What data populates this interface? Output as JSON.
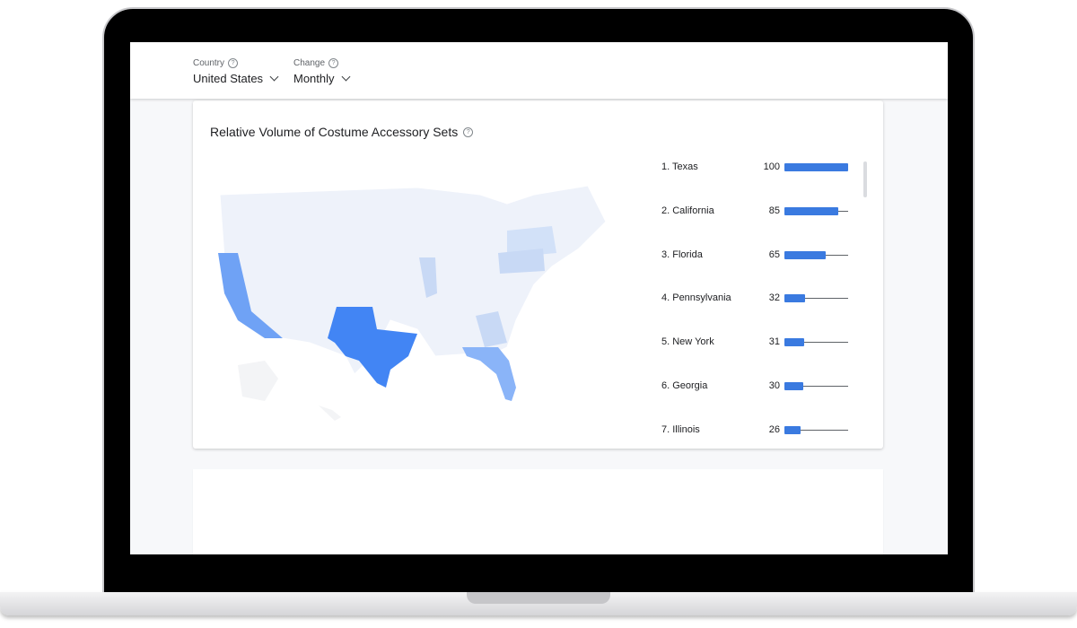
{
  "filters": {
    "country": {
      "label": "Country",
      "value": "United States"
    },
    "change": {
      "label": "Change",
      "value": "Monthly"
    }
  },
  "card": {
    "title": "Relative Volume of Costume Accessory Sets",
    "help_icon": "?"
  },
  "icons": {
    "help": "help-circle-icon",
    "chevron": "chevron-down-icon"
  },
  "colors": {
    "accent": "#3a7ae0",
    "texas": "#4285f4",
    "california": "#6fa2f5",
    "florida": "#8ab4f8",
    "map_base": "#eef2fa"
  },
  "rankings": [
    {
      "label": "1. Texas",
      "value": "100",
      "level": 100
    },
    {
      "label": "2. California",
      "value": "85",
      "level": 85
    },
    {
      "label": "3. Florida",
      "value": "65",
      "level": 65
    },
    {
      "label": "4. Pennsylvania",
      "value": "32",
      "level": 32
    },
    {
      "label": "5. New York",
      "value": "31",
      "level": 31
    },
    {
      "label": "6. Georgia",
      "value": "30",
      "level": 30
    },
    {
      "label": "7. Illinois",
      "value": "26",
      "level": 26
    }
  ]
}
